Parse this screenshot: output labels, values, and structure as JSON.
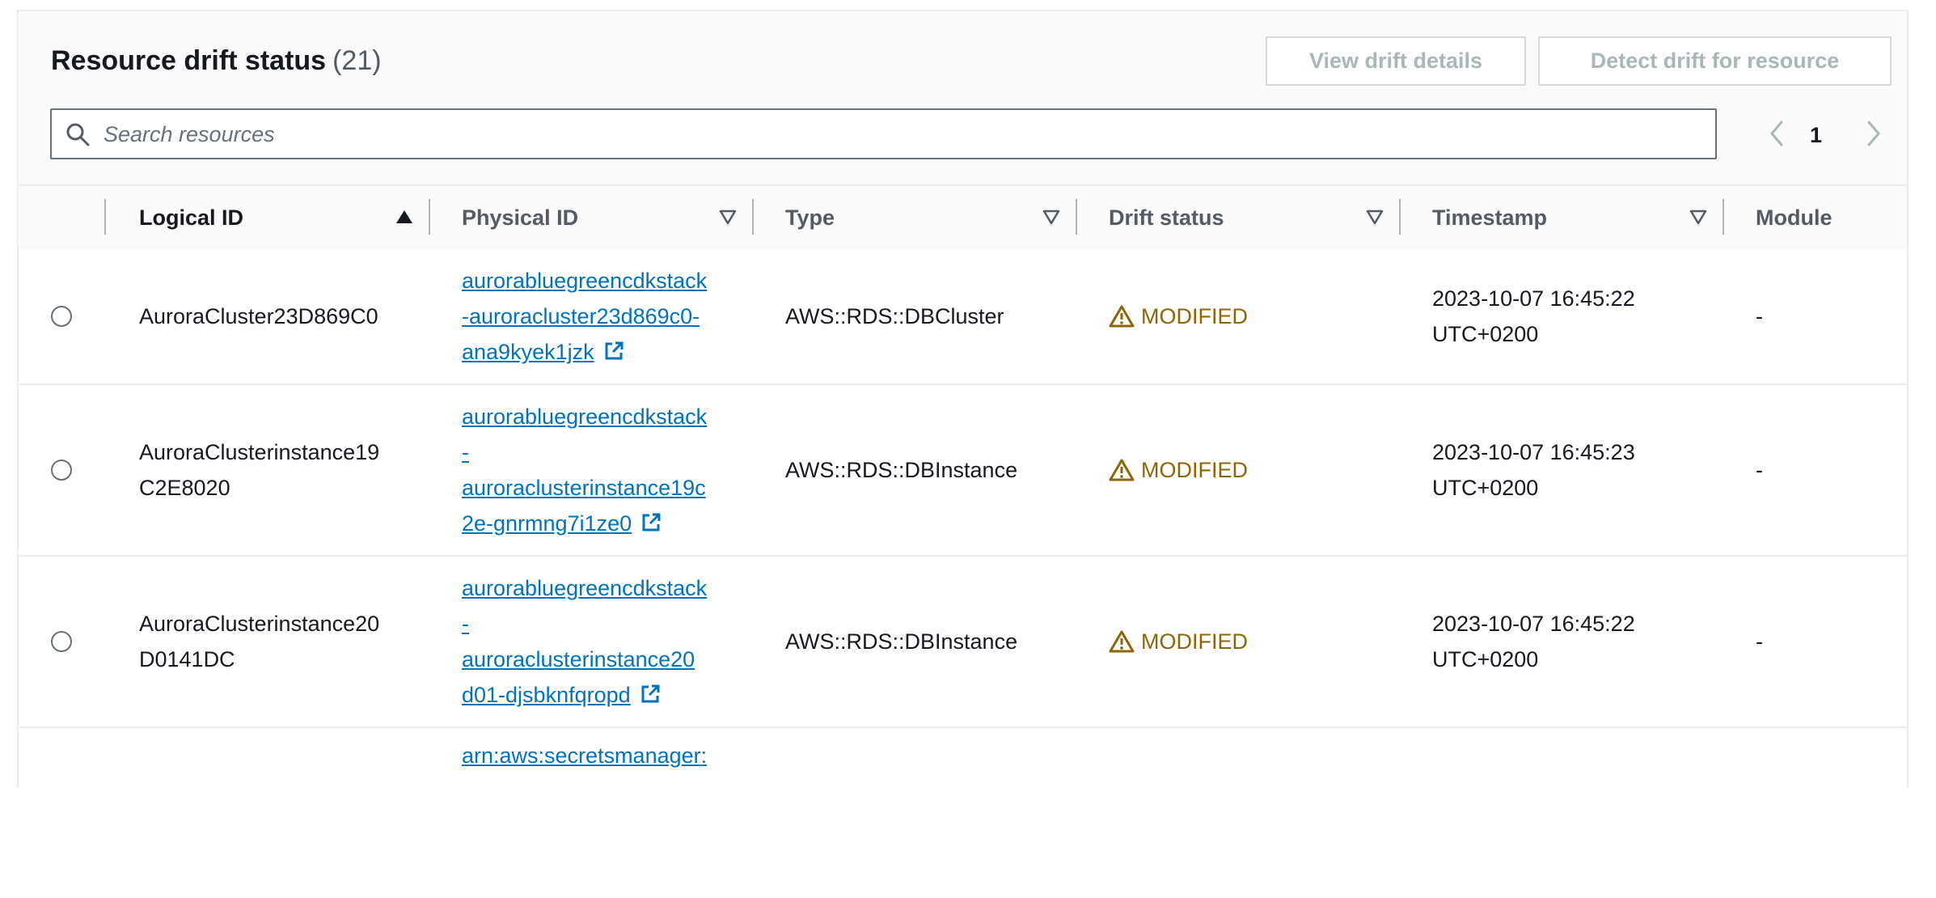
{
  "panel": {
    "title": "Resource drift status",
    "count": "(21)",
    "buttons": {
      "view": "View drift details",
      "detect": "Detect drift for resource"
    },
    "search": {
      "placeholder": "Search resources",
      "value": ""
    },
    "pagination": {
      "current_page": "1"
    }
  },
  "columns": {
    "logical_id": "Logical ID",
    "physical_id": "Physical ID",
    "type": "Type",
    "drift_status": "Drift status",
    "timestamp": "Timestamp",
    "module": "Module"
  },
  "rows": [
    {
      "logical_id": [
        "AuroraCluster23D869C0"
      ],
      "physical_id": [
        "aurorabluegreencdkstack",
        "-auroracluster23d869c0-",
        "ana9kyek1jzk"
      ],
      "type": "AWS::RDS::DBCluster",
      "drift_status": "MODIFIED",
      "timestamp": [
        "2023-10-07 16:45:22",
        "UTC+0200"
      ],
      "module": "-"
    },
    {
      "logical_id": [
        "AuroraClusterinstance19",
        "C2E8020"
      ],
      "physical_id": [
        "aurorabluegreencdkstack",
        "-",
        "auroraclusterinstance19c",
        "2e-gnrmng7i1ze0"
      ],
      "type": "AWS::RDS::DBInstance",
      "drift_status": "MODIFIED",
      "timestamp": [
        "2023-10-07 16:45:23",
        "UTC+0200"
      ],
      "module": "-"
    },
    {
      "logical_id": [
        "AuroraClusterinstance20",
        "D0141DC"
      ],
      "physical_id": [
        "aurorabluegreencdkstack",
        "-",
        "auroraclusterinstance20",
        "d01-djsbknfqropd"
      ],
      "type": "AWS::RDS::DBInstance",
      "drift_status": "MODIFIED",
      "timestamp": [
        "2023-10-07 16:45:22",
        "UTC+0200"
      ],
      "module": "-"
    },
    {
      "physical_id": [
        "arn:aws:secretsmanager:"
      ]
    }
  ],
  "colors": {
    "link": "#0073bb",
    "warning": "#8d6605",
    "header_text": "#545b64",
    "border": "#eaeded"
  },
  "icons": {
    "search": "search-icon",
    "prev": "chevron-left-icon",
    "next": "chevron-right-icon",
    "sort_asc": "sort-ascending-icon",
    "sort": "sort-caret-icon",
    "external": "external-link-icon",
    "warning": "warning-icon"
  }
}
